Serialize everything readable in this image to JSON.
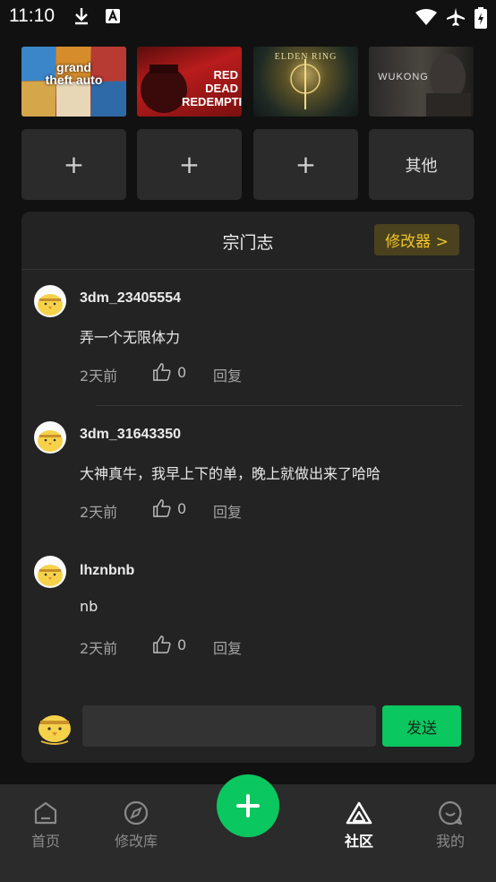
{
  "status_bar": {
    "time": "11:10"
  },
  "game_slots": {
    "add_symbol": "+",
    "other_label": "其他"
  },
  "thumbnails": [
    {
      "text": "grand theft auto"
    },
    {
      "text": "RED DEAD REDEMPTION"
    },
    {
      "text": "ELDEN RING"
    },
    {
      "text": "WUKONG"
    }
  ],
  "panel": {
    "title": "宗门志",
    "modifier_button": "修改器 >",
    "comments": [
      {
        "username": "3dm_23405554",
        "text": "弄一个无限体力",
        "time": "2天前",
        "likes": "0",
        "reply": "回复"
      },
      {
        "username": "3dm_31643350",
        "text": "大神真牛，我早上下的单，晚上就做出来了哈哈",
        "time": "2天前",
        "likes": "0",
        "reply": "回复"
      },
      {
        "username": "lhznbnb",
        "text": "nb",
        "time": "2天前",
        "likes": "0",
        "reply": "回复"
      }
    ],
    "input_value": "",
    "send_label": "发送"
  },
  "nav": {
    "items": [
      {
        "label": "首页",
        "icon": "home-icon"
      },
      {
        "label": "修改库",
        "icon": "compass-icon"
      },
      {
        "label": "社区",
        "icon": "triangle-icon",
        "active": true
      },
      {
        "label": "我的",
        "icon": "chat-bubble-icon"
      }
    ],
    "fab_symbol": "+"
  },
  "colors": {
    "accent": "#0bc760",
    "modifier_text": "#f0c42a",
    "modifier_bg": "#4a421e",
    "background": "#111111",
    "panel": "#232323"
  }
}
